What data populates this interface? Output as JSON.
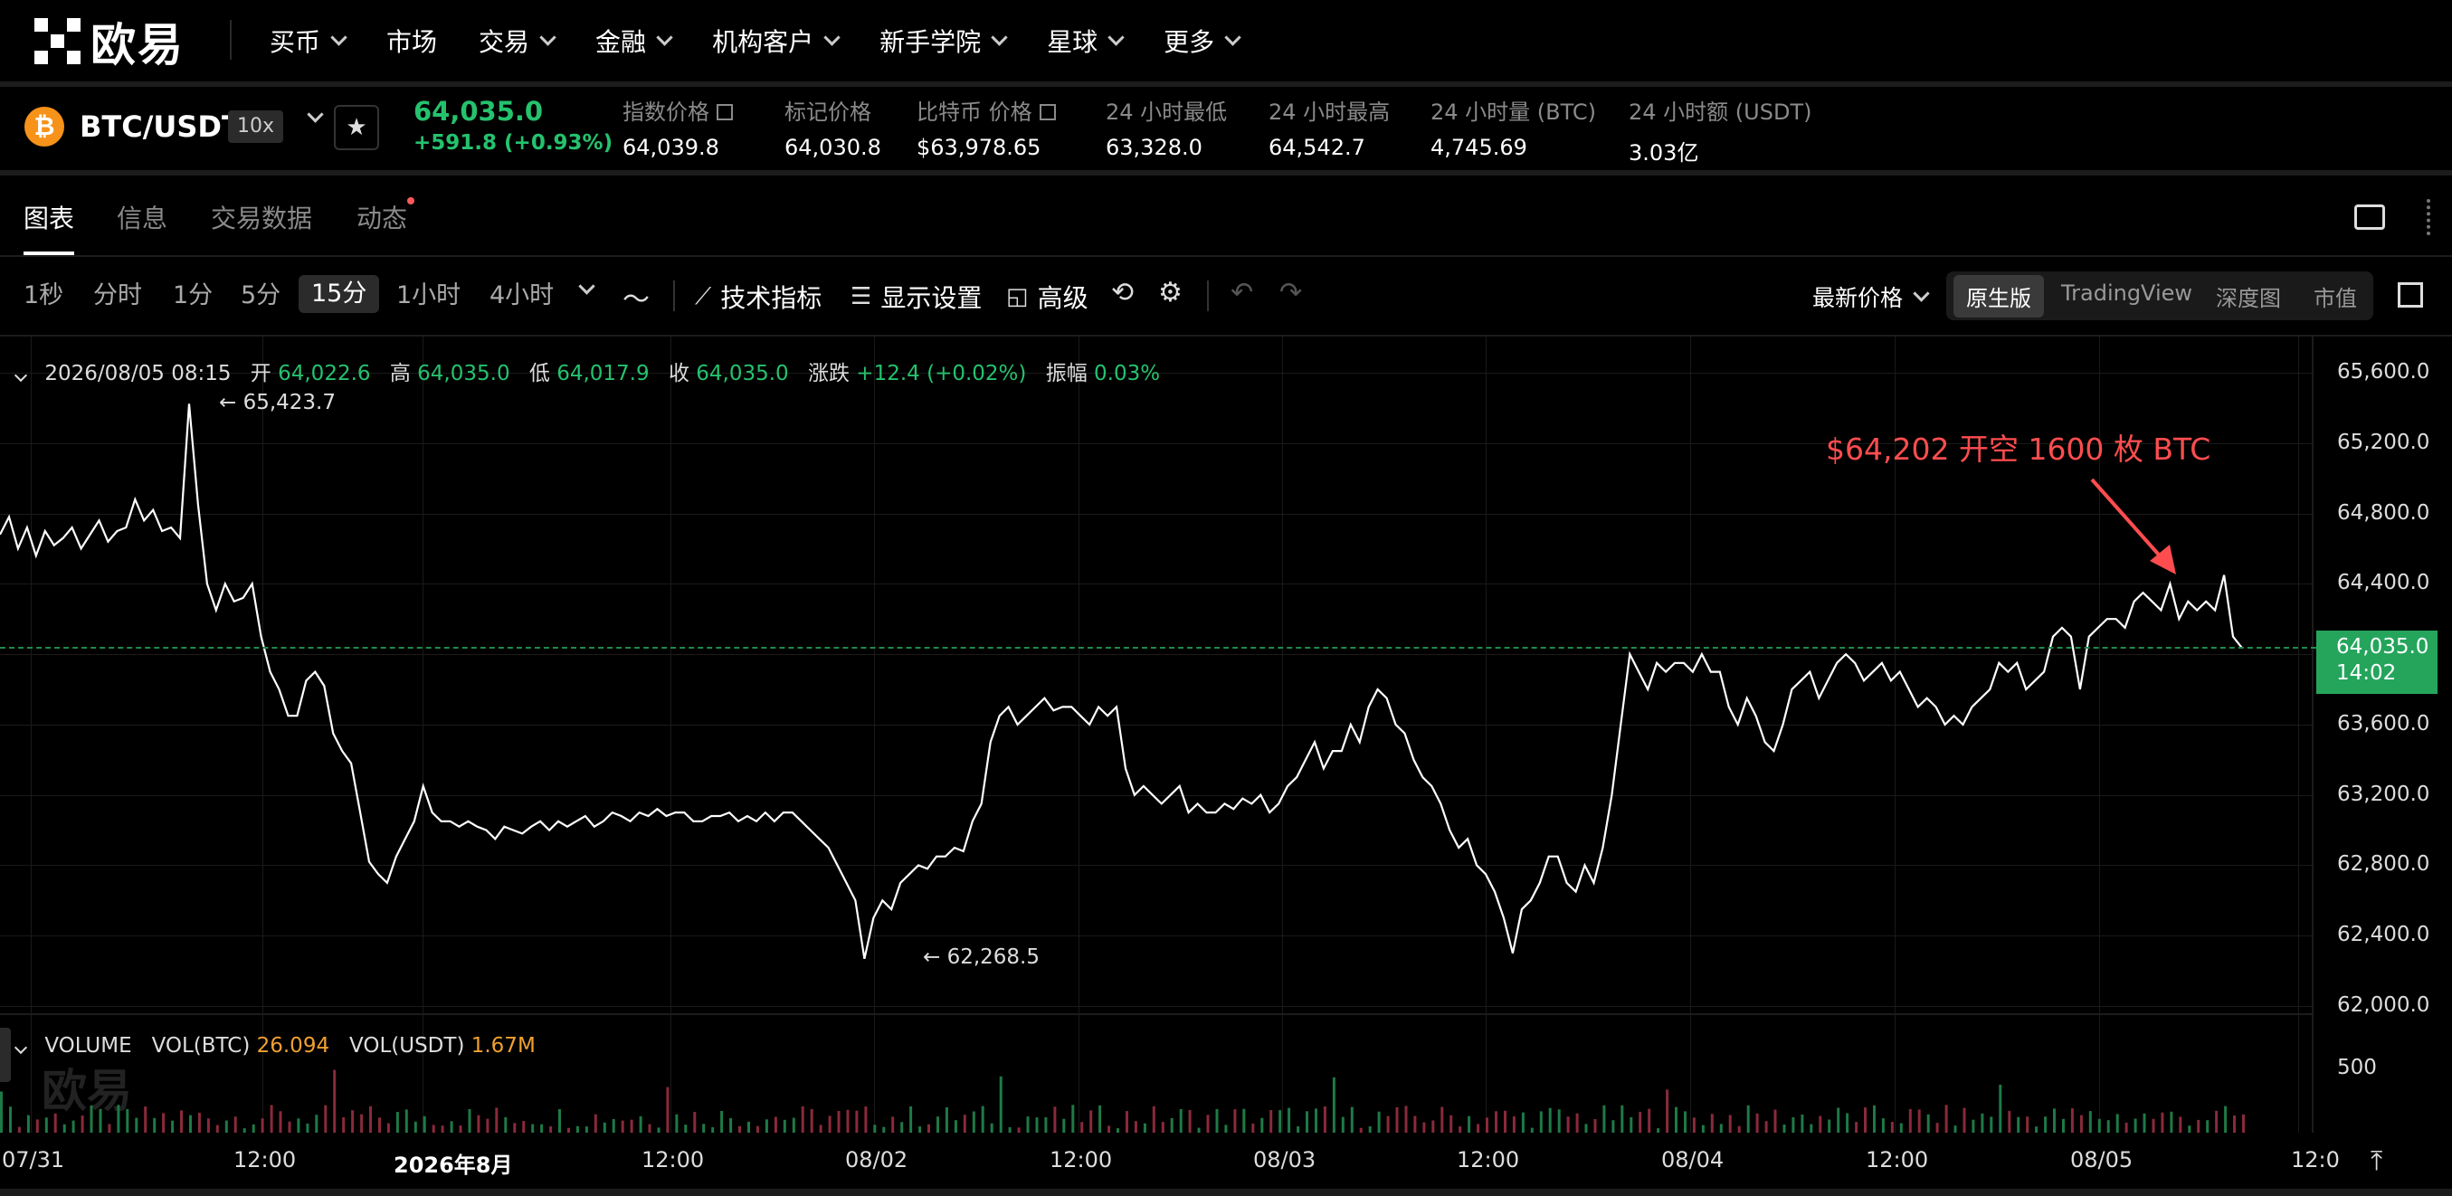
{
  "brand": {
    "name": "欧易"
  },
  "nav": {
    "items": [
      "买币",
      "市场",
      "交易",
      "金融",
      "机构客户",
      "新手学院",
      "星球",
      "更多"
    ],
    "has_dropdown": [
      true,
      false,
      true,
      true,
      true,
      true,
      true,
      true
    ]
  },
  "ticker": {
    "coin_icon": "₿",
    "pair": "BTC/USDT",
    "leverage": "10x",
    "last_price": "64,035.0",
    "change": "+591.8 (+0.93%)",
    "stats": [
      {
        "label": "指数价格",
        "value": "64,039.8",
        "link": true
      },
      {
        "label": "标记价格",
        "value": "64,030.8",
        "link": false
      },
      {
        "label": "比特币 价格",
        "value": "$63,978.65",
        "link": true
      },
      {
        "label": "24 小时最低",
        "value": "63,328.0",
        "link": false
      },
      {
        "label": "24 小时最高",
        "value": "64,542.7",
        "link": false
      },
      {
        "label": "24 小时量 (BTC)",
        "value": "4,745.69",
        "link": false
      },
      {
        "label": "24 小时额 (USDT)",
        "value": "3.03亿",
        "link": false
      }
    ]
  },
  "tabs": {
    "items": [
      "图表",
      "信息",
      "交易数据",
      "动态"
    ],
    "active": "图表"
  },
  "toolbar": {
    "timeframes": [
      "1秒",
      "分时",
      "1分",
      "5分",
      "15分",
      "1小时",
      "4小时"
    ],
    "active_timeframe": "15分",
    "indicators": "技术指标",
    "display": "显示设置",
    "advanced": "高级",
    "price_type": "最新价格",
    "views": [
      "原生版",
      "TradingView",
      "深度图",
      "市值"
    ],
    "active_view": "原生版"
  },
  "ohlc": {
    "datetime": "2026/08/05 08:15",
    "open_label": "开",
    "open": "64,022.6",
    "high_label": "高",
    "high": "64,035.0",
    "low_label": "低",
    "low": "64,017.9",
    "close_label": "收",
    "close": "64,035.0",
    "chg_label": "涨跌",
    "chg": "+12.4 (+0.02%)",
    "amp_label": "振幅",
    "amp": "0.03%"
  },
  "chart_data": {
    "type": "line",
    "y_ticks": [
      "65,600.0",
      "65,200.0",
      "64,800.0",
      "64,400.0",
      "64,000.0",
      "63,600.0",
      "63,200.0",
      "62,800.0",
      "62,400.0",
      "62,000.0"
    ],
    "ylim": [
      62000,
      65600
    ],
    "x_ticks": [
      "07/31",
      "12:00",
      "2026年8月",
      "12:00",
      "08/02",
      "12:00",
      "08/03",
      "12:00",
      "08/04",
      "12:00",
      "08/05",
      "12:0"
    ],
    "x_bold": [
      false,
      false,
      true,
      false,
      false,
      false,
      false,
      false,
      false,
      false,
      false,
      false
    ],
    "high_marker": "← 65,423.7",
    "low_marker": "← 62,268.5",
    "current_price": "64,035.0",
    "countdown": "14:02",
    "annotation": "$64,202 开空 1600 枚 BTC",
    "series": [
      {
        "values": [
          64680,
          64780,
          64600,
          64720,
          64560,
          64700,
          64620,
          64660,
          64720,
          64600,
          64680,
          64760,
          64640,
          64700,
          64720,
          64880,
          64760,
          64820,
          64700,
          64720,
          64660,
          65423.7,
          64850,
          64400,
          64250,
          64400,
          64300,
          64320,
          64400,
          64100,
          63900,
          63800,
          63650,
          63650,
          63850,
          63900,
          63820,
          63550,
          63450,
          63380,
          63100,
          62820,
          62750,
          62700,
          62850,
          62950,
          63050,
          63250,
          63100,
          63050,
          63050,
          63020,
          63050,
          63020,
          63000,
          62950,
          63020,
          63000,
          62980,
          63020,
          63050,
          63000,
          63050,
          63020,
          63050,
          63080,
          63020,
          63050,
          63100,
          63080,
          63050,
          63100,
          63080,
          63120,
          63080,
          63100,
          63100,
          63050,
          63050,
          63080,
          63080,
          63100,
          63050,
          63080,
          63050,
          63100,
          63050,
          63100,
          63100,
          63050,
          63000,
          62950,
          62900,
          62800,
          62700,
          62600,
          62268.5,
          62500,
          62600,
          62550,
          62700,
          62750,
          62800,
          62780,
          62850,
          62850,
          62900,
          62880,
          63050,
          63150,
          63500,
          63650,
          63700,
          63600,
          63650,
          63700,
          63750,
          63680,
          63700,
          63700,
          63650,
          63600,
          63700,
          63650,
          63700,
          63350,
          63200,
          63250,
          63200,
          63150,
          63200,
          63250,
          63100,
          63150,
          63100,
          63100,
          63150,
          63120,
          63180,
          63150,
          63200,
          63100,
          63150,
          63250,
          63300,
          63400,
          63500,
          63350,
          63450,
          63450,
          63600,
          63500,
          63700,
          63800,
          63750,
          63600,
          63550,
          63400,
          63300,
          63250,
          63150,
          63000,
          62900,
          62950,
          62800,
          62750,
          62650,
          62500,
          62300,
          62550,
          62600,
          62700,
          62850,
          62850,
          62700,
          62650,
          62800,
          62700,
          62900,
          63200,
          63600,
          64000,
          63900,
          63800,
          63950,
          63900,
          63950,
          63950,
          63900,
          64000,
          63900,
          63900,
          63700,
          63600,
          63750,
          63650,
          63500,
          63450,
          63600,
          63800,
          63850,
          63900,
          63750,
          63850,
          63950,
          64000,
          63950,
          63850,
          63900,
          63950,
          63850,
          63900,
          63800,
          63700,
          63750,
          63700,
          63600,
          63650,
          63600,
          63700,
          63750,
          63800,
          63950,
          63900,
          63950,
          63800,
          63850,
          63900,
          64100,
          64150,
          64100,
          63800,
          64100,
          64150,
          64200,
          64200,
          64150,
          64300,
          64350,
          64300,
          64250,
          64400,
          64200,
          64300,
          64250,
          64300,
          64250,
          64450,
          64100,
          64035
        ]
      }
    ],
    "volume": {
      "legend": "VOLUME",
      "vol_btc_label": "VOL(BTC)",
      "vol_btc": "26.094",
      "vol_usdt_label": "VOL(USDT)",
      "vol_usdt": "1.67M",
      "y_tick": "500",
      "ylim": [
        0,
        800
      ]
    }
  }
}
